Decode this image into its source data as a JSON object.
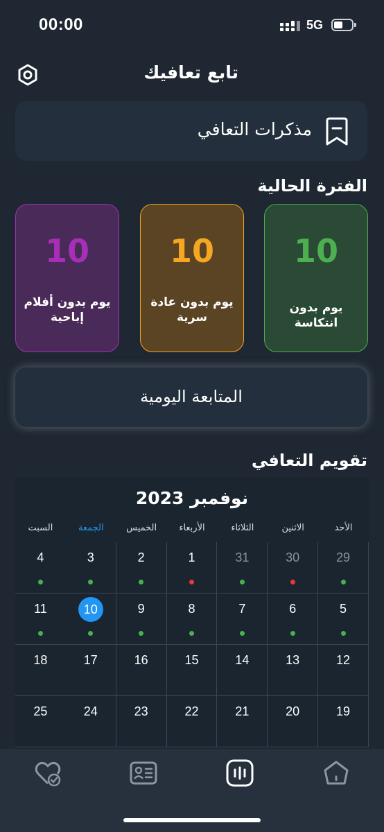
{
  "status_bar": {
    "time": "00:00",
    "network": "5G"
  },
  "header": {
    "title": "تابع تعافيك"
  },
  "memo_card": {
    "label": "مذكرات التعافي"
  },
  "current_period": {
    "title": "الفترة الحالية",
    "cards": [
      {
        "value": "10",
        "label": "يوم بدون انتكاسة",
        "color": "#4caf50",
        "bg": "#2a4a36"
      },
      {
        "value": "10",
        "label": "يوم بدون عادة سرية",
        "color": "#f5a623",
        "bg": "#5a4424"
      },
      {
        "value": "10",
        "label": "يوم بدون أفلام إباحية",
        "color": "#a62fb8",
        "bg": "#4a2a58"
      }
    ]
  },
  "daily_follow_up": {
    "label": "المتابعة اليومية"
  },
  "calendar": {
    "section_title": "تقويم التعافي",
    "month_title": "نوفمبر 2023",
    "weekdays": [
      "الأحد",
      "الاثنين",
      "الثلاثاء",
      "الأربعاء",
      "الخميس",
      "الجمعة",
      "السبت"
    ],
    "active_weekday_index": 5,
    "weeks": [
      [
        {
          "day": "29",
          "muted": true,
          "dot": "green"
        },
        {
          "day": "30",
          "muted": true,
          "dot": "red"
        },
        {
          "day": "31",
          "muted": true,
          "dot": "green"
        },
        {
          "day": "1",
          "muted": false,
          "dot": "red"
        },
        {
          "day": "2",
          "muted": false,
          "dot": "green"
        },
        {
          "day": "3",
          "muted": false,
          "dot": "green"
        },
        {
          "day": "4",
          "muted": false,
          "dot": "green"
        }
      ],
      [
        {
          "day": "5",
          "muted": false,
          "dot": "green"
        },
        {
          "day": "6",
          "muted": false,
          "dot": "green"
        },
        {
          "day": "7",
          "muted": false,
          "dot": "green"
        },
        {
          "day": "8",
          "muted": false,
          "dot": "green"
        },
        {
          "day": "9",
          "muted": false,
          "dot": "green"
        },
        {
          "day": "10",
          "muted": false,
          "dot": "green",
          "today": true
        },
        {
          "day": "11",
          "muted": false,
          "dot": "green"
        }
      ],
      [
        {
          "day": "12",
          "muted": false,
          "dot": null
        },
        {
          "day": "13",
          "muted": false,
          "dot": null
        },
        {
          "day": "14",
          "muted": false,
          "dot": null
        },
        {
          "day": "15",
          "muted": false,
          "dot": null
        },
        {
          "day": "16",
          "muted": false,
          "dot": null
        },
        {
          "day": "17",
          "muted": false,
          "dot": null
        },
        {
          "day": "18",
          "muted": false,
          "dot": null
        }
      ],
      [
        {
          "day": "19",
          "muted": false,
          "dot": null
        },
        {
          "day": "20",
          "muted": false,
          "dot": null
        },
        {
          "day": "21",
          "muted": false,
          "dot": null
        },
        {
          "day": "22",
          "muted": false,
          "dot": null
        },
        {
          "day": "23",
          "muted": false,
          "dot": null
        },
        {
          "day": "24",
          "muted": false,
          "dot": null
        },
        {
          "day": "25",
          "muted": false,
          "dot": null
        }
      ]
    ]
  },
  "colors": {
    "background": "#1e2732",
    "card": "#232f3c",
    "accent_blue": "#2196f3",
    "dot_green": "#4caf50",
    "dot_red": "#e53935"
  },
  "tab_bar": {
    "items": [
      {
        "icon": "home-icon",
        "active": false
      },
      {
        "icon": "stats-icon",
        "active": true
      },
      {
        "icon": "profile-card-icon",
        "active": false
      },
      {
        "icon": "heart-check-icon",
        "active": false
      }
    ]
  }
}
